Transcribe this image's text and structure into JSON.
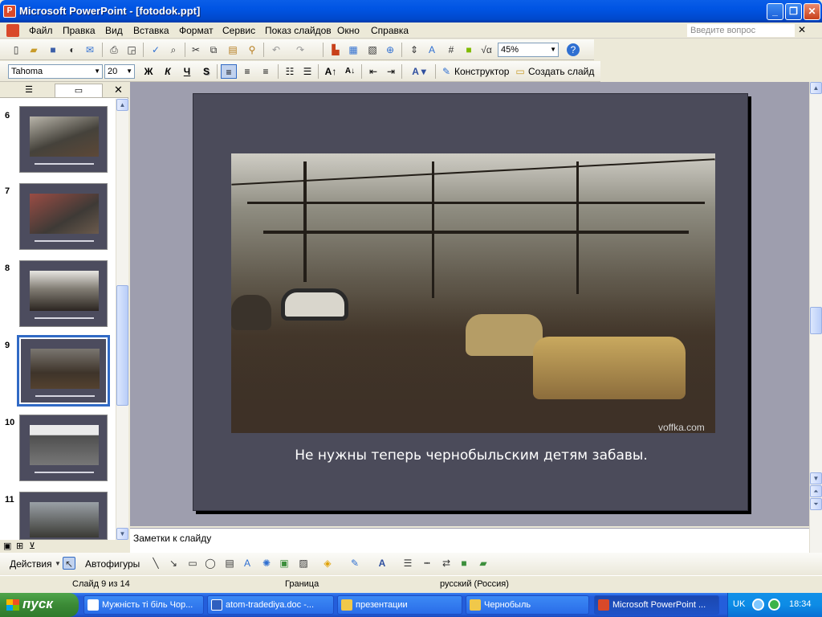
{
  "window": {
    "title": "Microsoft PowerPoint - [fotodok.ppt]"
  },
  "menu": {
    "items": [
      "Файл",
      "Правка",
      "Вид",
      "Вставка",
      "Формат",
      "Сервис",
      "Показ слайдов",
      "Окно",
      "Справка"
    ],
    "help_placeholder": "Введите вопрос"
  },
  "standard_toolbar": {
    "zoom": "45%"
  },
  "format_toolbar": {
    "font": "Tahoma",
    "size": "20",
    "bold": "Ж",
    "italic": "К",
    "underline": "Ч",
    "shadow": "S",
    "designer": "Конструктор",
    "new_slide": "Создать слайд"
  },
  "slide_panel": {
    "thumbnails": [
      "6",
      "7",
      "8",
      "9",
      "10",
      "11"
    ],
    "selected": "9"
  },
  "slide": {
    "caption": "Не нужны теперь чернобыльским детям забавы.",
    "watermark": "voffka.com"
  },
  "notes": {
    "placeholder": "Заметки к слайду"
  },
  "drawing_toolbar": {
    "actions": "Действия",
    "autoshapes": "Автофигуры"
  },
  "status": {
    "slide": "Слайд 9 из 14",
    "design": "Граница",
    "language": "русский (Россия)"
  },
  "taskbar": {
    "start": "пуск",
    "tasks": [
      "Мужність ті біль Чор...",
      "atom-tradediya.doc -...",
      "презентации",
      "Чернобыль",
      "Microsoft PowerPoint ..."
    ],
    "lang": "UK",
    "time": "18:34"
  }
}
